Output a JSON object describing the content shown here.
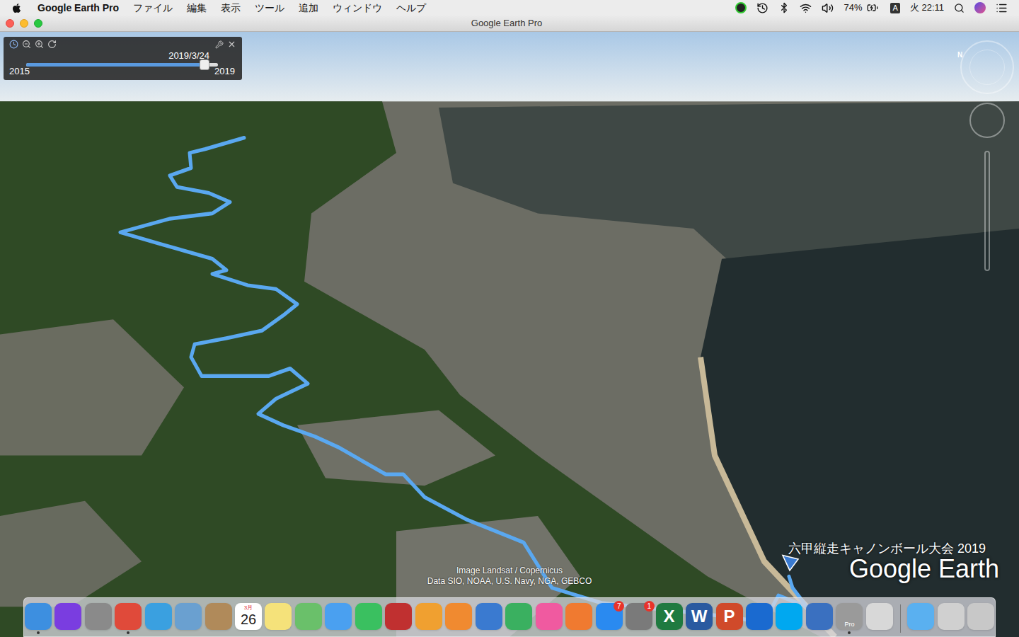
{
  "menu_bar": {
    "app": "Google Earth Pro",
    "menus": [
      "ファイル",
      "編集",
      "表示",
      "ツール",
      "追加",
      "ウィンドウ",
      "ヘルプ"
    ],
    "status": {
      "battery": "74%",
      "input": "A",
      "clock": "火 22:11"
    }
  },
  "window": {
    "title": "Google Earth Pro"
  },
  "time_slider": {
    "current": "2019/3/24",
    "start": "2015",
    "end": "2019",
    "level": 0.93
  },
  "map": {
    "compass": "N",
    "track_label": "六甲縦走キャノンボール大会 2019",
    "logo": "Google Earth",
    "attribution": [
      "Image Landsat / Copernicus",
      "Data SIO, NOAA, U.S. Navy, NGA, GEBCO"
    ]
  },
  "dock": [
    {
      "kind": "app",
      "color": "#3d8fe0",
      "running": true
    },
    {
      "kind": "app",
      "color": "#7a3de0",
      "running": false
    },
    {
      "kind": "app",
      "color": "#8a8a8a",
      "running": false
    },
    {
      "kind": "app",
      "color": "#e04a3a",
      "running": true
    },
    {
      "kind": "app",
      "color": "#3aa0e0",
      "running": false
    },
    {
      "kind": "app",
      "color": "#6aa0d0",
      "running": false
    },
    {
      "kind": "app",
      "color": "#b08a5a",
      "running": false
    },
    {
      "kind": "calendar",
      "month": "3月",
      "day": "26",
      "running": false
    },
    {
      "kind": "app",
      "color": "#f5e27a",
      "running": false
    },
    {
      "kind": "app",
      "color": "#6ac06a",
      "running": false
    },
    {
      "kind": "app",
      "color": "#4aa0f0",
      "running": false
    },
    {
      "kind": "app",
      "color": "#3ac060",
      "running": false
    },
    {
      "kind": "app",
      "color": "#c03030",
      "running": false
    },
    {
      "kind": "app",
      "color": "#f0a030",
      "running": false
    },
    {
      "kind": "app",
      "color": "#f08a30",
      "running": false
    },
    {
      "kind": "app",
      "color": "#3a7ad0",
      "running": false
    },
    {
      "kind": "app",
      "color": "#3ab060",
      "running": false
    },
    {
      "kind": "app",
      "color": "#f05aa0",
      "running": false
    },
    {
      "kind": "app",
      "color": "#f07a30",
      "running": false
    },
    {
      "kind": "app",
      "color": "#2a8af0",
      "badge": "7",
      "running": false
    },
    {
      "kind": "app",
      "color": "#7a7a7a",
      "badge": "1",
      "running": false
    },
    {
      "kind": "app",
      "color": "#1f7a40",
      "glyph": "X",
      "running": false
    },
    {
      "kind": "app",
      "color": "#2a5aa0",
      "glyph": "W",
      "running": false
    },
    {
      "kind": "app",
      "color": "#d04a2a",
      "glyph": "P",
      "running": false
    },
    {
      "kind": "app",
      "color": "#1a6ad0",
      "running": false
    },
    {
      "kind": "app",
      "color": "#00a8f0",
      "running": false
    },
    {
      "kind": "app",
      "color": "#3a70c0",
      "running": false
    },
    {
      "kind": "app",
      "color": "#9a9a9a",
      "label": "Pro",
      "running": true
    },
    {
      "kind": "app",
      "color": "#d8d8d8",
      "running": false
    },
    {
      "kind": "separator"
    },
    {
      "kind": "app",
      "color": "#5ab0f0",
      "running": false
    },
    {
      "kind": "app",
      "color": "#d0d0d0",
      "running": false
    },
    {
      "kind": "app",
      "color": "#c8c8c8",
      "running": false
    }
  ]
}
